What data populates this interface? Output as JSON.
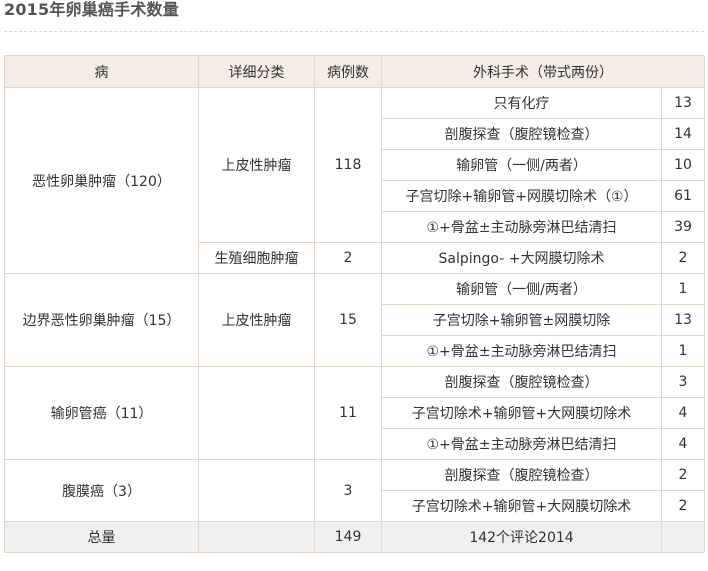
{
  "title": "2015年卵巢癌手术数量",
  "headers": {
    "disease": "病",
    "subtype": "详细分类",
    "cases": "病例数",
    "surgery": "外科手术（带式两份）",
    "count": ""
  },
  "groups": [
    {
      "disease": "恶性卵巢肿瘤（120）",
      "subtypes": [
        {
          "name": "上皮性肿瘤",
          "cases": "118",
          "procedures": [
            {
              "name": "只有化疗",
              "count": "13"
            },
            {
              "name": "剖腹探查（腹腔镜检查）",
              "count": "14"
            },
            {
              "name": "输卵管（一侧/两者）",
              "count": "10"
            },
            {
              "name": "子宫切除+输卵管+网膜切除术（①）",
              "count": "61"
            },
            {
              "name": "①+骨盆±主动脉旁淋巴结清扫",
              "count": "39"
            }
          ]
        },
        {
          "name": "生殖细胞肿瘤",
          "cases": "2",
          "procedures": [
            {
              "name": "Salpingo- +大网膜切除术",
              "count": "2"
            }
          ]
        }
      ]
    },
    {
      "disease": "边界恶性卵巢肿瘤（15）",
      "subtypes": [
        {
          "name": "上皮性肿瘤",
          "cases": "15",
          "procedures": [
            {
              "name": "输卵管（一侧/两者）",
              "count": "1"
            },
            {
              "name": "子宫切除+输卵管±网膜切除",
              "count": "13"
            },
            {
              "name": "①+骨盆±主动脉旁淋巴结清扫",
              "count": "1"
            }
          ]
        }
      ]
    },
    {
      "disease": "输卵管癌（11）",
      "subtypes": [
        {
          "name": "",
          "cases": "11",
          "procedures": [
            {
              "name": "剖腹探查（腹腔镜检查）",
              "count": "3"
            },
            {
              "name": "子宫切除术+输卵管+大网膜切除术",
              "count": "4"
            },
            {
              "name": "①+骨盆±主动脉旁淋巴结清扫",
              "count": "4"
            }
          ]
        }
      ]
    },
    {
      "disease": "腹膜癌（3）",
      "subtypes": [
        {
          "name": "",
          "cases": "3",
          "procedures": [
            {
              "name": "剖腹探查（腹腔镜检查）",
              "count": "2"
            },
            {
              "name": "子宫切除术+输卵管+大网膜切除术",
              "count": "2"
            }
          ]
        }
      ]
    }
  ],
  "total": {
    "label": "总量",
    "subtype": "",
    "cases": "149",
    "surgery": "142个评论2014",
    "count": ""
  }
}
